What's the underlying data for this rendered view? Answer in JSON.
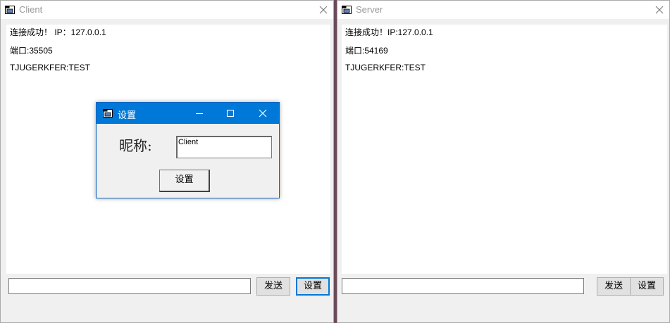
{
  "client": {
    "title": "Client",
    "messages": [
      "连接成功！ IP：127.0.0.1",
      "端口:35505",
      "TJUGERKFER:TEST"
    ],
    "input_value": "",
    "send_label": "发送",
    "set_label": "设置"
  },
  "server": {
    "title": "Server",
    "messages": [
      "连接成功！IP:127.0.0.1",
      "端口:54169",
      "TJUGERKFER:TEST"
    ],
    "input_value": "",
    "send_label": "发送",
    "set_label": "设置"
  },
  "dialog": {
    "title": "设置",
    "nickname_label": "昵称:",
    "nickname_value": "Client",
    "confirm_label": "设置"
  },
  "icons": {
    "app": "window-icon",
    "close": "close-icon",
    "minimize": "minimize-icon",
    "maximize": "maximize-icon"
  },
  "colors": {
    "dialog_titlebar": "#0078d7",
    "focus_border": "#0078d7",
    "inactive_title": "#999999"
  }
}
